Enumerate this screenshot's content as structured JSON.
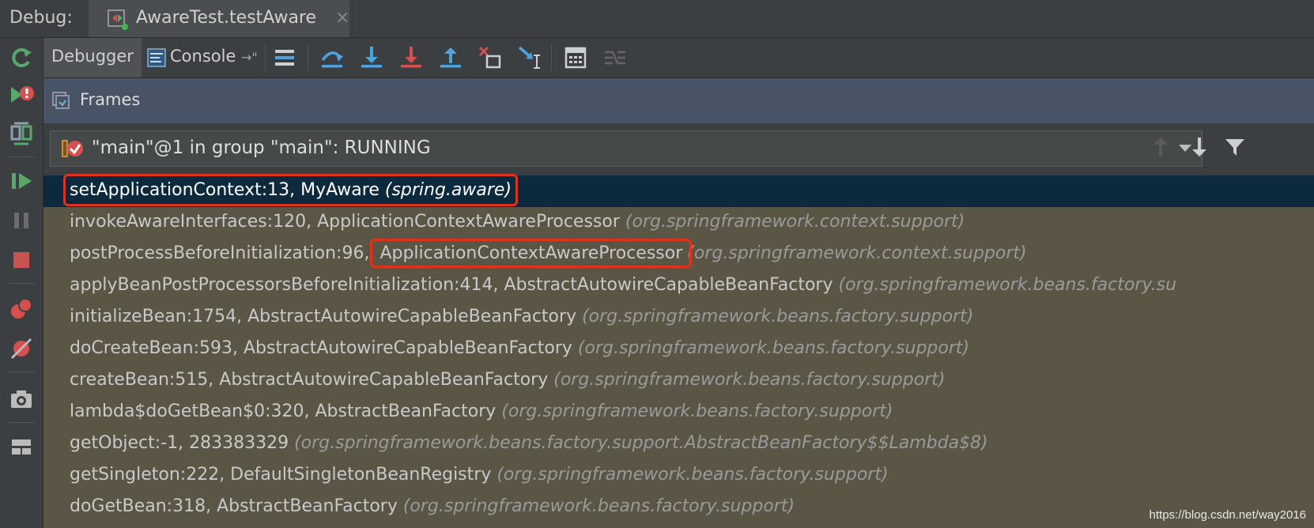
{
  "header": {
    "panel_label": "Debug:",
    "session_tab": "AwareTest.testAware",
    "close_glyph": "×"
  },
  "toolbar": {
    "tabs": [
      {
        "label": "Debugger",
        "active": true
      },
      {
        "label": "Console",
        "suffix": "→\""
      }
    ]
  },
  "frames_panel": {
    "title": "Frames",
    "thread": "\"main\"@1 in group \"main\": RUNNING"
  },
  "frames": [
    {
      "method": "setApplicationContext:13, MyAware",
      "package": "(spring.aware)",
      "selected": true
    },
    {
      "method": "invokeAwareInterfaces:120, ApplicationContextAwareProcessor",
      "package": "(org.springframework.context.support)"
    },
    {
      "method_prefix": "postProcessBeforeInitialization:96, ",
      "method_class": "ApplicationContextAwareProcessor",
      "package": "(org.springframework.context.support)"
    },
    {
      "method": "applyBeanPostProcessorsBeforeInitialization:414, AbstractAutowireCapableBeanFactory",
      "package": "(org.springframework.beans.factory.su"
    },
    {
      "method": "initializeBean:1754, AbstractAutowireCapableBeanFactory",
      "package": "(org.springframework.beans.factory.support)"
    },
    {
      "method": "doCreateBean:593, AbstractAutowireCapableBeanFactory",
      "package": "(org.springframework.beans.factory.support)"
    },
    {
      "method": "createBean:515, AbstractAutowireCapableBeanFactory",
      "package": "(org.springframework.beans.factory.support)"
    },
    {
      "method": "lambda$doGetBean$0:320, AbstractBeanFactory",
      "package": "(org.springframework.beans.factory.support)"
    },
    {
      "method": "getObject:-1, 283383329",
      "package": "(org.springframework.beans.factory.support.AbstractBeanFactory$$Lambda$8)"
    },
    {
      "method": "getSingleton:222, DefaultSingletonBeanRegistry",
      "package": "(org.springframework.beans.factory.support)"
    },
    {
      "method": "doGetBean:318, AbstractBeanFactory",
      "package": "(org.springframework.beans.factory.support)"
    }
  ],
  "watermark": "https://blog.csdn.net/way2016",
  "colors": {
    "highlight": "#e0311c",
    "selected_row": "#0d293e",
    "frames_bg": "#5a5545",
    "header_bg": "#485466"
  }
}
